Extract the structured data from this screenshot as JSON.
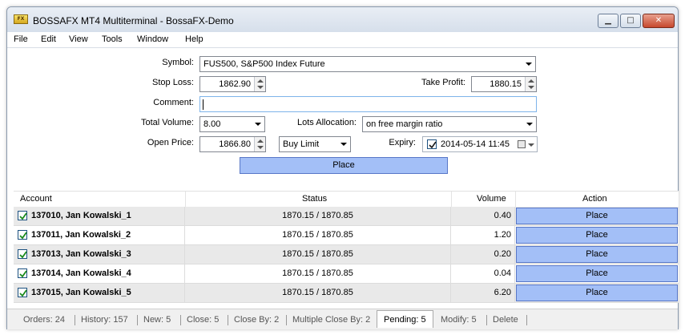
{
  "window": {
    "title": "BOSSAFX MT4 Multiterminal - BossaFX-Demo",
    "icon_label": "FX",
    "controls": {
      "minimize": "▁",
      "maximize": "□",
      "close": "✕"
    }
  },
  "menu": [
    "File",
    "Edit",
    "View",
    "Tools",
    "Window",
    "Help"
  ],
  "form": {
    "symbol_label": "Symbol:",
    "symbol_value": "FUS500,  S&P500 Index Future",
    "stop_loss_label": "Stop Loss:",
    "stop_loss_value": "1862.90",
    "take_profit_label": "Take Profit:",
    "take_profit_value": "1880.15",
    "comment_label": "Comment:",
    "comment_value": "",
    "total_volume_label": "Total Volume:",
    "total_volume_value": "8.00",
    "lots_allocation_label": "Lots Allocation:",
    "lots_allocation_value": "on free margin ratio",
    "open_price_label": "Open Price:",
    "open_price_value": "1866.80",
    "order_type_value": "Buy Limit",
    "expiry_label": "Expiry:",
    "expiry_checked": true,
    "expiry_value": "2014-05-14 11:45",
    "place_label": "Place"
  },
  "grid": {
    "columns": [
      "Account",
      "Status",
      "Volume",
      "Action"
    ],
    "rows": [
      {
        "account": "137010, Jan Kowalski_1",
        "status": "1870.15 / 1870.85",
        "volume": "0.40",
        "action": "Place",
        "checked": true
      },
      {
        "account": "137011, Jan Kowalski_2",
        "status": "1870.15 / 1870.85",
        "volume": "1.20",
        "action": "Place",
        "checked": true
      },
      {
        "account": "137013, Jan Kowalski_3",
        "status": "1870.15 / 1870.85",
        "volume": "0.20",
        "action": "Place",
        "checked": true
      },
      {
        "account": "137014, Jan Kowalski_4",
        "status": "1870.15 / 1870.85",
        "volume": "0.04",
        "action": "Place",
        "checked": true
      },
      {
        "account": "137015, Jan Kowalski_5",
        "status": "1870.15 / 1870.85",
        "volume": "6.20",
        "action": "Place",
        "checked": true
      }
    ]
  },
  "tabs": [
    {
      "label": "Orders: 24",
      "active": false
    },
    {
      "label": "History: 157",
      "active": false
    },
    {
      "label": "New: 5",
      "active": false
    },
    {
      "label": "Close: 5",
      "active": false
    },
    {
      "label": "Close By: 2",
      "active": false
    },
    {
      "label": "Multiple Close By: 2",
      "active": false
    },
    {
      "label": "Pending: 5",
      "active": true
    },
    {
      "label": "Modify: 5",
      "active": false
    },
    {
      "label": "Delete",
      "active": false
    }
  ],
  "colors": {
    "button_fill": "#a3bff7",
    "check_mark": "#1a8a1a",
    "row_alt": "#e9e9e9"
  }
}
